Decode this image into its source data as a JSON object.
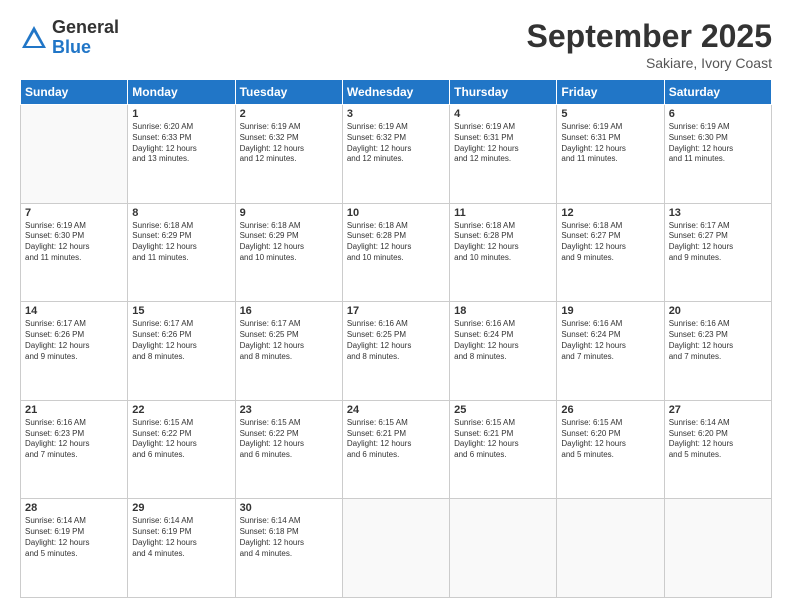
{
  "logo": {
    "general": "General",
    "blue": "Blue"
  },
  "header": {
    "month": "September 2025",
    "location": "Sakiare, Ivory Coast"
  },
  "days": [
    "Sunday",
    "Monday",
    "Tuesday",
    "Wednesday",
    "Thursday",
    "Friday",
    "Saturday"
  ],
  "weeks": [
    [
      {
        "num": "",
        "info": ""
      },
      {
        "num": "1",
        "info": "Sunrise: 6:20 AM\nSunset: 6:33 PM\nDaylight: 12 hours\nand 13 minutes."
      },
      {
        "num": "2",
        "info": "Sunrise: 6:19 AM\nSunset: 6:32 PM\nDaylight: 12 hours\nand 12 minutes."
      },
      {
        "num": "3",
        "info": "Sunrise: 6:19 AM\nSunset: 6:32 PM\nDaylight: 12 hours\nand 12 minutes."
      },
      {
        "num": "4",
        "info": "Sunrise: 6:19 AM\nSunset: 6:31 PM\nDaylight: 12 hours\nand 12 minutes."
      },
      {
        "num": "5",
        "info": "Sunrise: 6:19 AM\nSunset: 6:31 PM\nDaylight: 12 hours\nand 11 minutes."
      },
      {
        "num": "6",
        "info": "Sunrise: 6:19 AM\nSunset: 6:30 PM\nDaylight: 12 hours\nand 11 minutes."
      }
    ],
    [
      {
        "num": "7",
        "info": "Sunrise: 6:19 AM\nSunset: 6:30 PM\nDaylight: 12 hours\nand 11 minutes."
      },
      {
        "num": "8",
        "info": "Sunrise: 6:18 AM\nSunset: 6:29 PM\nDaylight: 12 hours\nand 11 minutes."
      },
      {
        "num": "9",
        "info": "Sunrise: 6:18 AM\nSunset: 6:29 PM\nDaylight: 12 hours\nand 10 minutes."
      },
      {
        "num": "10",
        "info": "Sunrise: 6:18 AM\nSunset: 6:28 PM\nDaylight: 12 hours\nand 10 minutes."
      },
      {
        "num": "11",
        "info": "Sunrise: 6:18 AM\nSunset: 6:28 PM\nDaylight: 12 hours\nand 10 minutes."
      },
      {
        "num": "12",
        "info": "Sunrise: 6:18 AM\nSunset: 6:27 PM\nDaylight: 12 hours\nand 9 minutes."
      },
      {
        "num": "13",
        "info": "Sunrise: 6:17 AM\nSunset: 6:27 PM\nDaylight: 12 hours\nand 9 minutes."
      }
    ],
    [
      {
        "num": "14",
        "info": "Sunrise: 6:17 AM\nSunset: 6:26 PM\nDaylight: 12 hours\nand 9 minutes."
      },
      {
        "num": "15",
        "info": "Sunrise: 6:17 AM\nSunset: 6:26 PM\nDaylight: 12 hours\nand 8 minutes."
      },
      {
        "num": "16",
        "info": "Sunrise: 6:17 AM\nSunset: 6:25 PM\nDaylight: 12 hours\nand 8 minutes."
      },
      {
        "num": "17",
        "info": "Sunrise: 6:16 AM\nSunset: 6:25 PM\nDaylight: 12 hours\nand 8 minutes."
      },
      {
        "num": "18",
        "info": "Sunrise: 6:16 AM\nSunset: 6:24 PM\nDaylight: 12 hours\nand 8 minutes."
      },
      {
        "num": "19",
        "info": "Sunrise: 6:16 AM\nSunset: 6:24 PM\nDaylight: 12 hours\nand 7 minutes."
      },
      {
        "num": "20",
        "info": "Sunrise: 6:16 AM\nSunset: 6:23 PM\nDaylight: 12 hours\nand 7 minutes."
      }
    ],
    [
      {
        "num": "21",
        "info": "Sunrise: 6:16 AM\nSunset: 6:23 PM\nDaylight: 12 hours\nand 7 minutes."
      },
      {
        "num": "22",
        "info": "Sunrise: 6:15 AM\nSunset: 6:22 PM\nDaylight: 12 hours\nand 6 minutes."
      },
      {
        "num": "23",
        "info": "Sunrise: 6:15 AM\nSunset: 6:22 PM\nDaylight: 12 hours\nand 6 minutes."
      },
      {
        "num": "24",
        "info": "Sunrise: 6:15 AM\nSunset: 6:21 PM\nDaylight: 12 hours\nand 6 minutes."
      },
      {
        "num": "25",
        "info": "Sunrise: 6:15 AM\nSunset: 6:21 PM\nDaylight: 12 hours\nand 6 minutes."
      },
      {
        "num": "26",
        "info": "Sunrise: 6:15 AM\nSunset: 6:20 PM\nDaylight: 12 hours\nand 5 minutes."
      },
      {
        "num": "27",
        "info": "Sunrise: 6:14 AM\nSunset: 6:20 PM\nDaylight: 12 hours\nand 5 minutes."
      }
    ],
    [
      {
        "num": "28",
        "info": "Sunrise: 6:14 AM\nSunset: 6:19 PM\nDaylight: 12 hours\nand 5 minutes."
      },
      {
        "num": "29",
        "info": "Sunrise: 6:14 AM\nSunset: 6:19 PM\nDaylight: 12 hours\nand 4 minutes."
      },
      {
        "num": "30",
        "info": "Sunrise: 6:14 AM\nSunset: 6:18 PM\nDaylight: 12 hours\nand 4 minutes."
      },
      {
        "num": "",
        "info": ""
      },
      {
        "num": "",
        "info": ""
      },
      {
        "num": "",
        "info": ""
      },
      {
        "num": "",
        "info": ""
      }
    ]
  ]
}
